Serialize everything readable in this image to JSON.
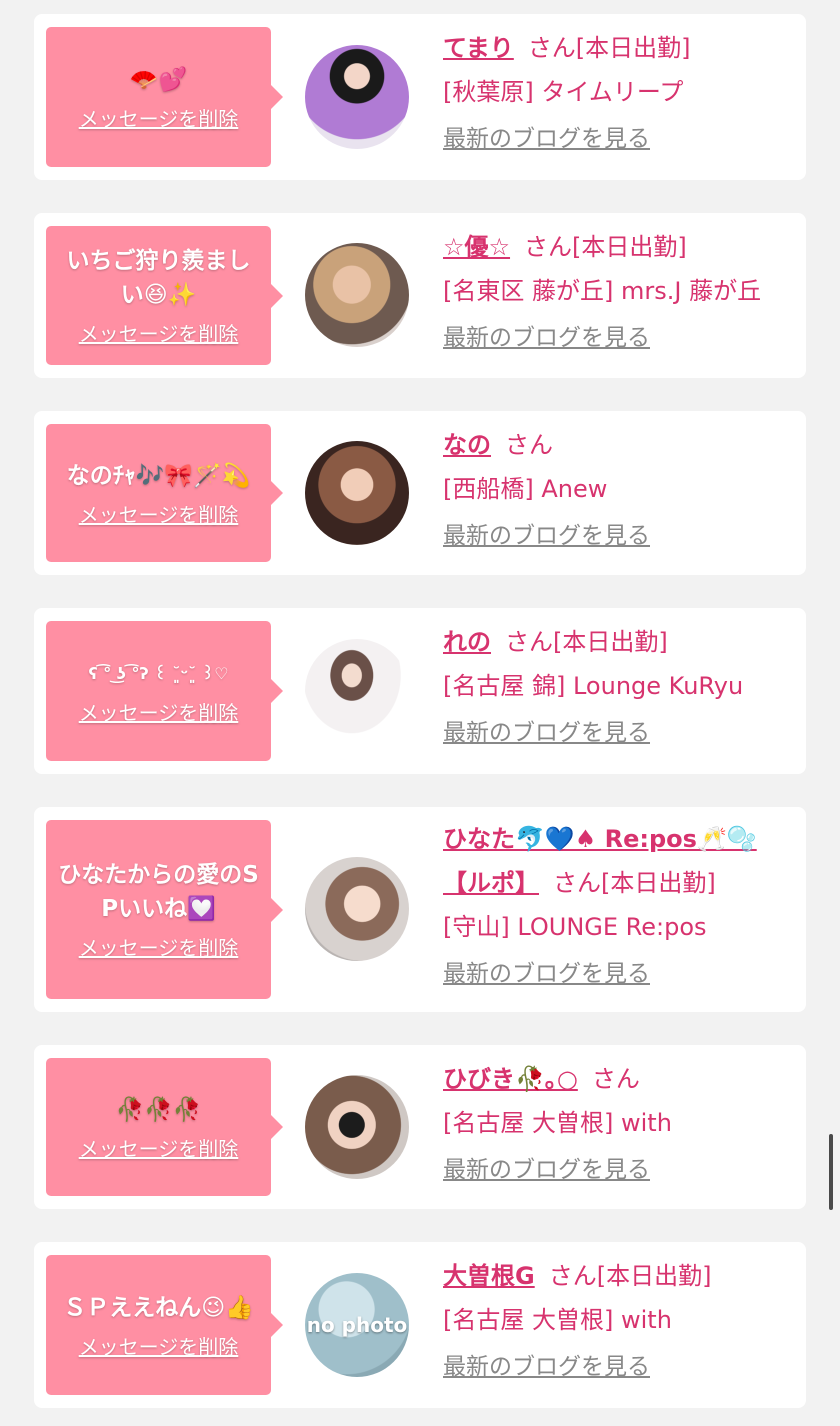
{
  "cards": [
    {
      "message": "🪭💕",
      "delete_label": "メッセージを削除",
      "name": "てまり",
      "suffix": "さん[本日出勤]",
      "shop": "[秋葉原] タイムリープ",
      "blog_label": "最新のブログを見る"
    },
    {
      "message": "いちご狩り羨ましい😆✨",
      "delete_label": "メッセージを削除",
      "name": "☆優☆",
      "suffix": "さん[本日出勤]",
      "shop": "[名東区 藤が丘] mrs.J 藤が丘",
      "blog_label": "最新のブログを見る"
    },
    {
      "message": "なのﾁｬ🎶🎀🪄💫",
      "delete_label": "メッセージを削除",
      "name": "なの",
      "suffix": "さん",
      "shop": "[西船橋] Anew",
      "blog_label": "最新のブログを見る"
    },
    {
      "message": "ʕ ͡° ͜ʖ ͡°ʔ ꒰ ˘͈ᵕ˘͈ ꒱♡",
      "delete_label": "メッセージを削除",
      "name": "れの",
      "suffix": "さん[本日出勤]",
      "shop": "[名古屋 錦] Lounge KuRyu",
      "blog_label": "最新のブログを見る"
    },
    {
      "message": "ひなたからの愛のSPいいね💟",
      "delete_label": "メッセージを削除",
      "name": "ひなた🐬💙♠ Re:pos🥂🫧【ルポ】",
      "suffix": "さん[本日出勤]",
      "shop": "[守山] LOUNGE Re:pos",
      "blog_label": "最新のブログを見る"
    },
    {
      "message": "🥀🥀🥀",
      "delete_label": "メッセージを削除",
      "name": "ひびき🥀｡○",
      "suffix": "さん",
      "shop": "[名古屋 大曽根] with",
      "blog_label": "最新のブログを見る"
    },
    {
      "message": "ＳＰええねん😉👍",
      "delete_label": "メッセージを削除",
      "name": "大曽根G",
      "suffix": "さん[本日出勤]",
      "shop": "[名古屋 大曽根] with",
      "blog_label": "最新のブログを見る",
      "avatar_text": "no photo"
    }
  ],
  "colors": {
    "bubble": "#ff8fa3",
    "accent": "#d7336e",
    "link_gray": "#888888",
    "background": "#f2f2f2"
  }
}
